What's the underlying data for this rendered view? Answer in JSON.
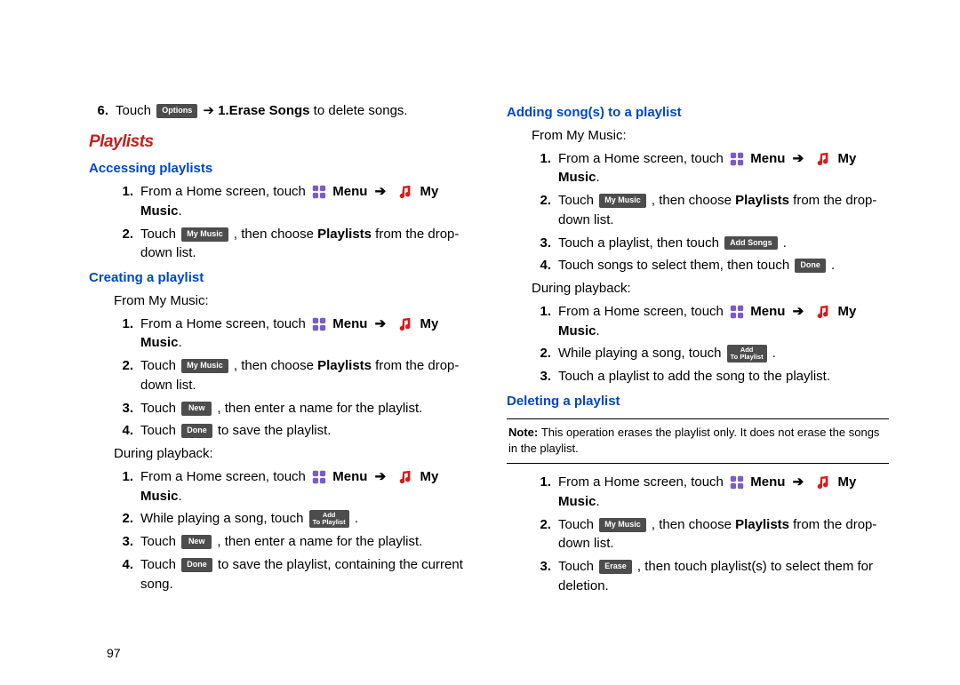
{
  "page_number": "97",
  "arrow": "➔",
  "labels": {
    "options": "Options",
    "mymusic": "My Music",
    "new": "New",
    "done": "Done",
    "erase": "Erase",
    "addsongs": "Add Songs",
    "add": "Add",
    "toplaylist": "To Playlist",
    "menu": "Menu",
    "mymusic_b": "My Music"
  },
  "left": {
    "step6_pre": "Touch ",
    "step6_mid": " ➔ ",
    "step6_bold": "1.Erase Songs",
    "step6_post": " to delete songs.",
    "playlists_title": "Playlists",
    "accessing_title": "Accessing playlists",
    "a1_pre": "From a Home screen, touch ",
    "a2_pre": "Touch ",
    "a2_mid": ", then choose ",
    "a2_bold": "Playlists",
    "a2_post": " from the drop-down list.",
    "creating_title": "Creating a playlist",
    "from_mymusic": "From My Music:",
    "c1_pre": "From a Home screen, touch ",
    "c2_pre": "Touch ",
    "c2_mid": ", then choose ",
    "c2_bold": "Playlists",
    "c2_post": " from the drop-down list.",
    "c3_pre": "Touch ",
    "c3_post": ", then enter a name for the playlist.",
    "c4_pre": "Touch ",
    "c4_post": " to save the playlist.",
    "during_playback": "During playback:",
    "d1_pre": "From a Home screen, touch ",
    "d2_pre": "While playing a song, touch ",
    "d2_post": ".",
    "d3_pre": "Touch ",
    "d3_post": ", then enter a name for the playlist.",
    "d4_pre": "Touch ",
    "d4_post": " to save the playlist, containing the current song."
  },
  "right": {
    "adding_title": "Adding song(s) to a playlist",
    "from_mymusic": "From My Music:",
    "a1_pre": "From a Home screen, touch ",
    "a2_pre": "Touch ",
    "a2_mid": ", then choose ",
    "a2_bold": "Playlists",
    "a2_post": " from the drop-down list.",
    "a3_pre": "Touch a playlist, then touch ",
    "a3_post": ".",
    "a4_pre": "Touch songs to select them, then touch ",
    "a4_post": ".",
    "during_playback": "During playback:",
    "p1_pre": "From a Home screen, touch ",
    "p2_pre": "While playing a song, touch ",
    "p2_post": ".",
    "p3": "Touch a playlist to add the song to the playlist.",
    "deleting_title": "Deleting a playlist",
    "note_label": "Note: ",
    "note_text": "This operation erases the playlist only. It does not erase the songs in the playlist.",
    "del1_pre": "From a Home screen, touch ",
    "del2_pre": "Touch ",
    "del2_mid": ", then choose ",
    "del2_bold": "Playlists",
    "del2_post": " from the drop-down list.",
    "del3_pre": "Touch ",
    "del3_post": ", then touch playlist(s) to select them for deletion."
  }
}
